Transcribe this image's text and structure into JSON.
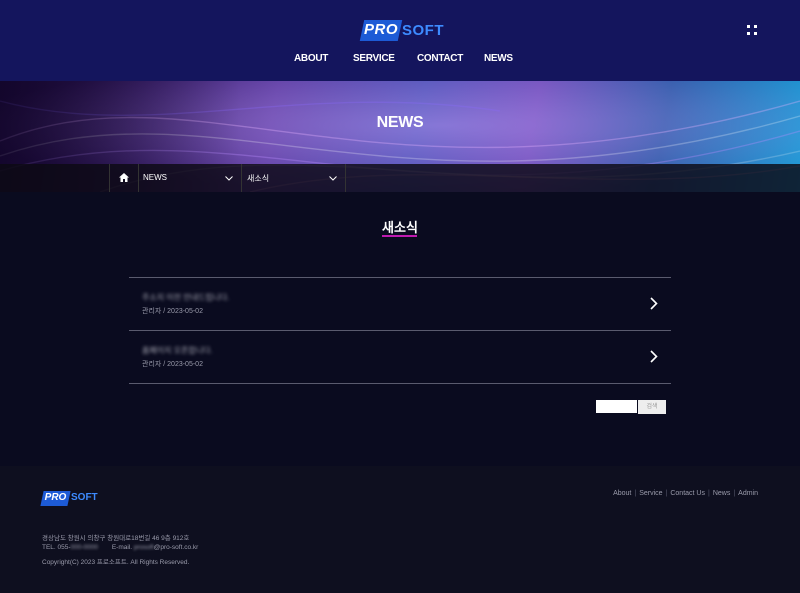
{
  "header": {
    "logo_pro": "PRO",
    "logo_soft": "SOFT",
    "nav": [
      "ABOUT",
      "SERVICE",
      "CONTACT",
      "NEWS"
    ]
  },
  "hero": {
    "title": "NEWS"
  },
  "breadcrumb": {
    "menu1": "NEWS",
    "menu2": "새소식"
  },
  "main": {
    "title": "새소식",
    "posts": [
      {
        "title": "주소지 이전 안내드립니다.",
        "meta": "관리자 / 2023-05-02"
      },
      {
        "title": "홈페이지 오픈합니다.",
        "meta": "관리자 / 2023-05-02"
      }
    ],
    "search": {
      "button": "검색",
      "placeholder": ""
    }
  },
  "footer": {
    "logo_pro": "PRO",
    "logo_soft": "SOFT",
    "links": [
      "About",
      "Service",
      "Contact Us",
      "News",
      "Admin"
    ],
    "address": "경상남도 창원시 의창구 창원대로18번길 46 9층 912호",
    "tel_label": "TEL. 055-",
    "tel_hidden": "000-0000",
    "email_label": "E-mail.",
    "email_hidden": "prosoft",
    "email_domain": "@pro-soft.co.kr",
    "copyright": "Copyright(C) 2023 프로소프트. All Rights Reserved."
  },
  "colors": {
    "header_bg": "#14155d",
    "accent": "#c01ab0",
    "brand_blue": "#1d5bd6"
  }
}
